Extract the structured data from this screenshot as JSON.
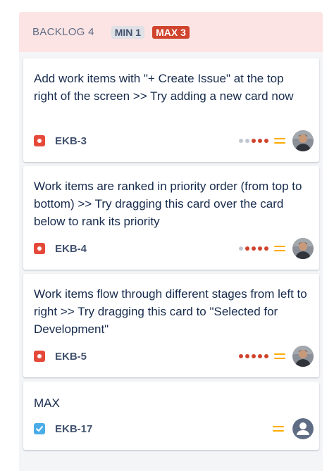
{
  "column": {
    "title": "BACKLOG 4",
    "min_badge": "MIN 1",
    "max_badge": "MAX 3"
  },
  "colors": {
    "header_bg": "#fce4e4",
    "max_badge": "#d0432c",
    "bug": "#e5493a",
    "task": "#4bade8",
    "priority_medium": "#ffab00"
  },
  "cards": [
    {
      "summary": "Add work items with \"+ Create Issue\" at the top right of the screen >> Try adding a new card now",
      "key": "EKB-3",
      "type": "bug",
      "priority": "medium",
      "estimate_dots": {
        "filled": 3,
        "total": 5
      },
      "assignee": "photo"
    },
    {
      "summary": "Work items are ranked in priority order (from top to bottom) >> Try dragging this card over the card below to rank its priority",
      "key": "EKB-4",
      "type": "bug",
      "priority": "medium",
      "estimate_dots": {
        "filled": 4,
        "total": 5
      },
      "assignee": "photo"
    },
    {
      "summary": "Work items flow through different stages from left to right >> Try dragging this card to \"Selected for Development\"",
      "key": "EKB-5",
      "type": "bug",
      "priority": "medium",
      "estimate_dots": {
        "filled": 5,
        "total": 5
      },
      "assignee": "photo"
    },
    {
      "summary": "MAX",
      "key": "EKB-17",
      "type": "task",
      "priority": "medium",
      "estimate_dots": null,
      "assignee": "unassigned"
    }
  ]
}
